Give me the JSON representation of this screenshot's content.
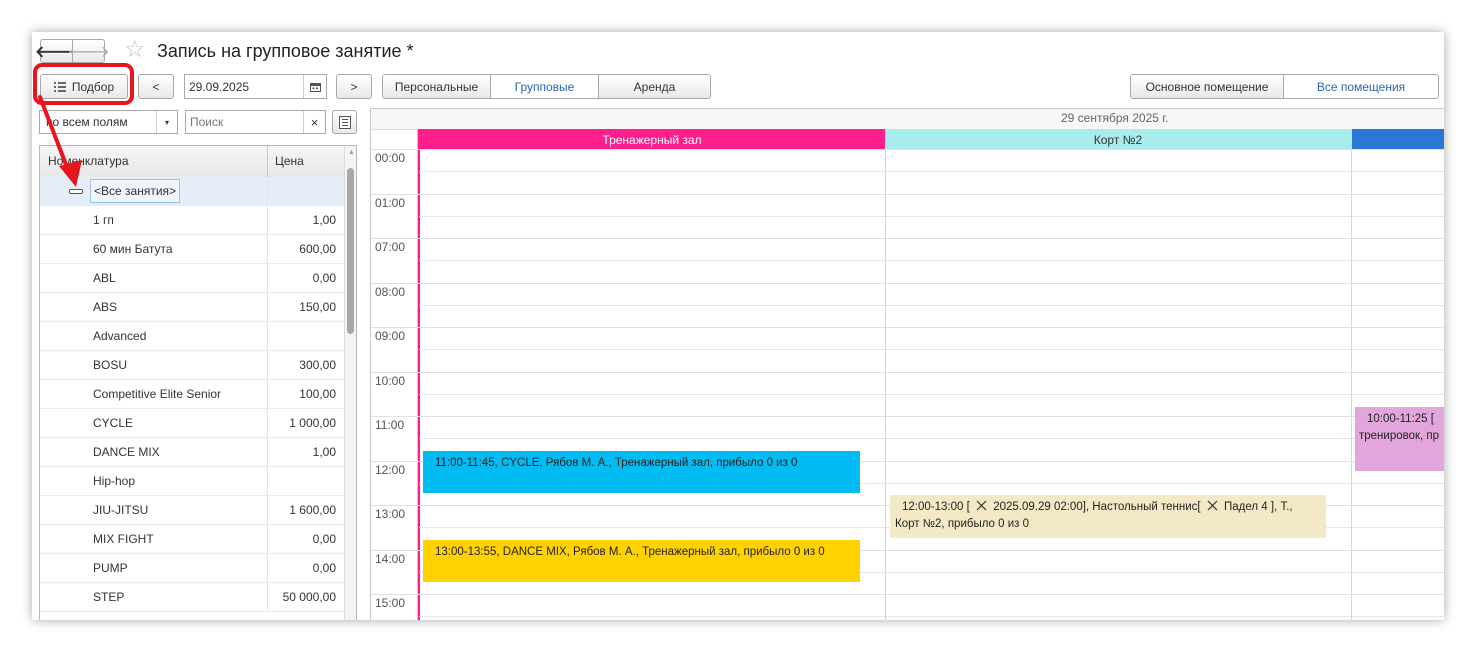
{
  "title": "Запись на групповое занятие *",
  "toolbar": {
    "back_glyph": "🡐",
    "forward_glyph": "🡒",
    "favorite_glyph": "☆",
    "podbor_label": "Подбор",
    "prev_label": "<",
    "next_label": ">",
    "date_value": "29.09.2025",
    "view_tabs": [
      "Персональные",
      "Групповые",
      "Аренда"
    ],
    "room_tabs": [
      "Основное помещение",
      "Все помещения"
    ]
  },
  "search": {
    "field_value": "по всем полям",
    "placeholder": "Поиск",
    "clear_glyph": "×"
  },
  "table": {
    "col_name": "Номенклатура",
    "col_price": "Цена",
    "group_label": "<Все занятия>",
    "rows": [
      {
        "name": "1 гп",
        "price": "1,00"
      },
      {
        "name": "60 мин Батута",
        "price": "600,00"
      },
      {
        "name": "ABL",
        "price": "0,00"
      },
      {
        "name": "ABS",
        "price": "150,00"
      },
      {
        "name": "Advanced",
        "price": ""
      },
      {
        "name": "BOSU",
        "price": "300,00"
      },
      {
        "name": "Competitive Elite Senior",
        "price": "100,00"
      },
      {
        "name": "CYCLE",
        "price": "1 000,00"
      },
      {
        "name": "DANCE MIX",
        "price": "1,00"
      },
      {
        "name": "Hip-hop",
        "price": ""
      },
      {
        "name": "JIU-JITSU",
        "price": "1 600,00"
      },
      {
        "name": "MIX FIGHT",
        "price": "0,00"
      },
      {
        "name": "PUMP",
        "price": "0,00"
      },
      {
        "name": "STEP",
        "price": "50 000,00"
      }
    ]
  },
  "schedule": {
    "date_header": "29 сентября 2025 г.",
    "times": [
      "00:00",
      "01:00",
      "07:00",
      "08:00",
      "09:00",
      "10:00",
      "11:00",
      "12:00",
      "13:00",
      "14:00",
      "15:00"
    ],
    "rooms": [
      {
        "name": "Тренажерный зал",
        "color": "#ff1e8c"
      },
      {
        "name": "Корт №2",
        "color": "#a8ecec"
      },
      {
        "name": "",
        "color": "#2a78d4"
      }
    ],
    "events": {
      "cycle": "11:00-11:45, CYCLE, Рябов М. А., Тренажерный зал, прибыло 0 из 0",
      "dance": "13:00-13:55, DANCE MIX, Рябов М. А., Тренажерный зал, прибыло 0 из 0",
      "tennis_a": "12:00-13:00 [",
      "tennis_b": "2025.09.29 02:00], Настольный теннис[",
      "tennis_c": "Падел 4 ], Т.,",
      "tennis_line2": "Корт №2, прибыло 0 из 0",
      "other_line1": "10:00-11:25 [",
      "other_line2": "тренировок, пр"
    },
    "event_colors": {
      "cycle": "#00bcf2",
      "dance": "#ffd200",
      "tennis": "#f3e9c6",
      "other": "#e2a6dc"
    }
  },
  "annotation_color": "#e8141e"
}
